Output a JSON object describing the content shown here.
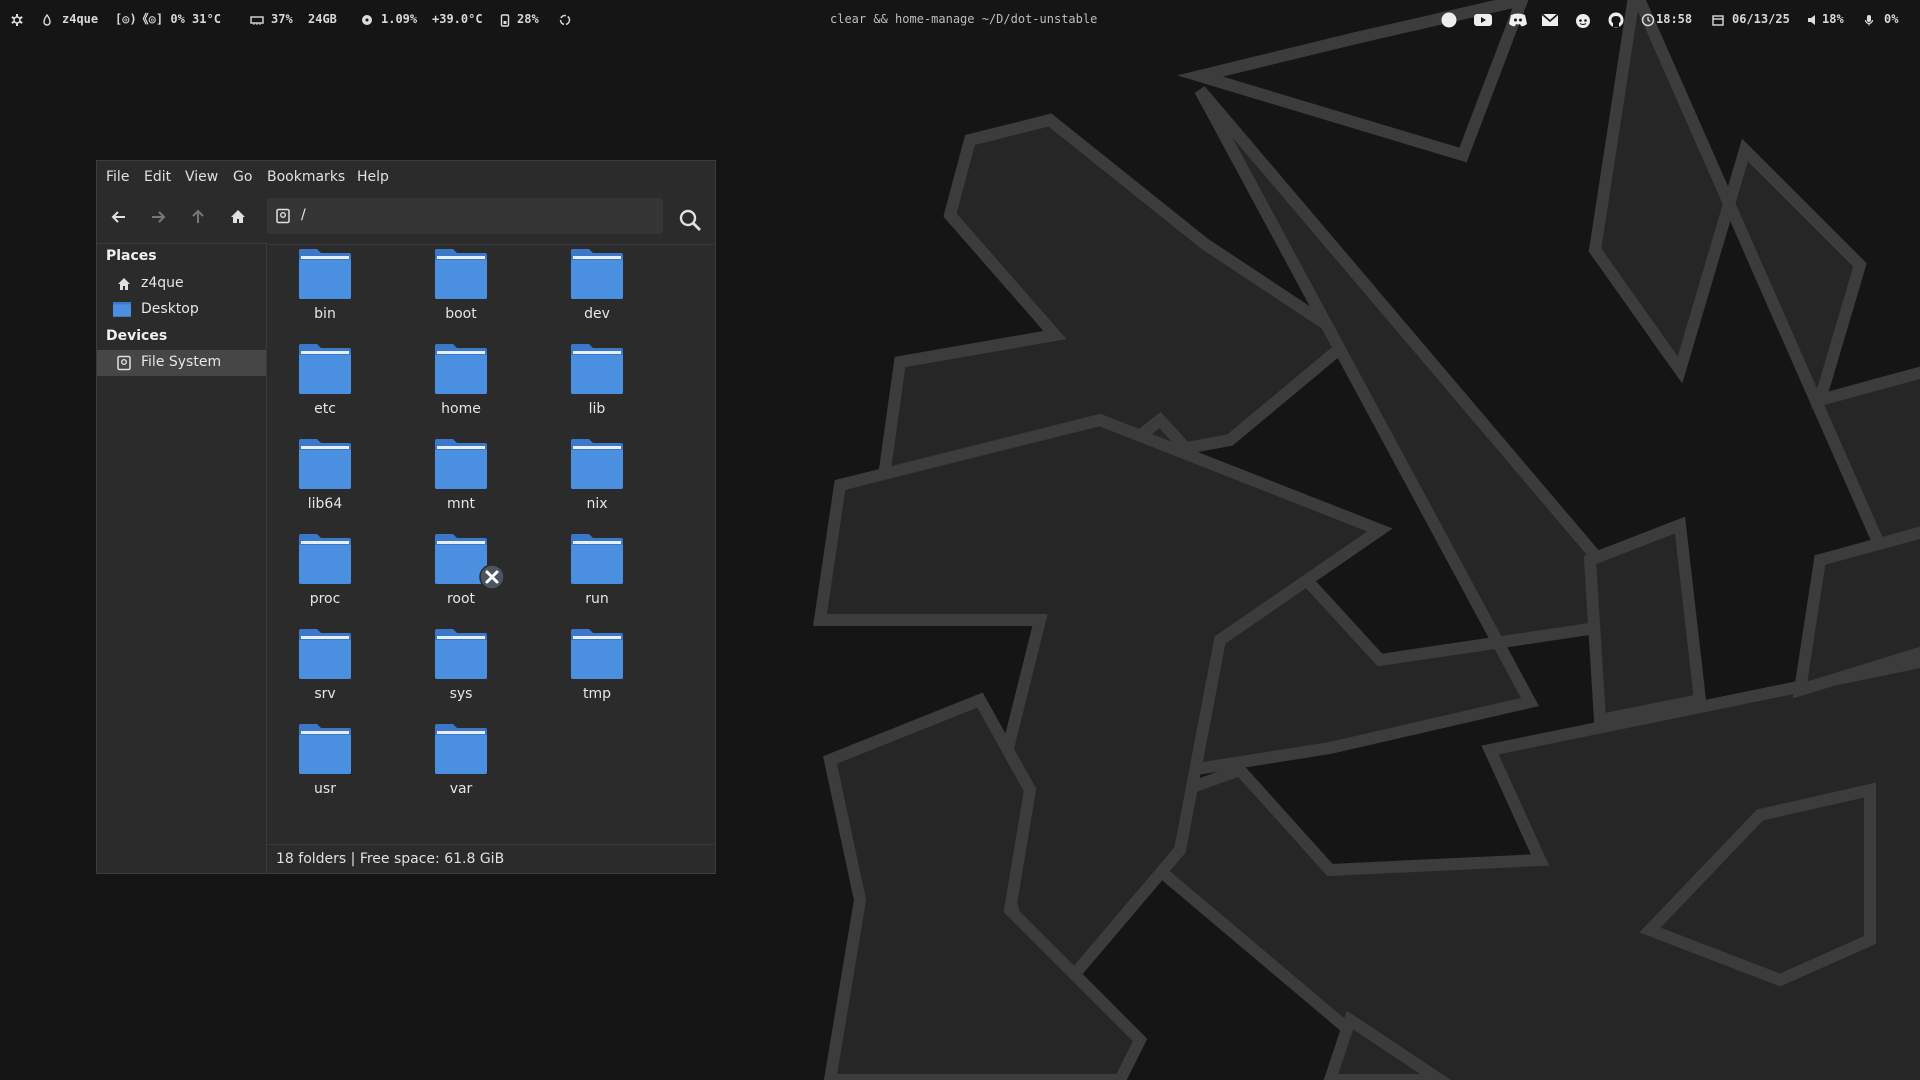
{
  "topbar": {
    "user": "z4que",
    "cpu_label": "[◎)《◎] 0% 31°C",
    "memory": "37%",
    "memory_size": "24GB",
    "disk": "1.09%",
    "temp": "+39.0°C",
    "battery": "28%",
    "window_title": "clear && home-manage ~/D/dot-unstable",
    "clock": "18:58",
    "date": "06/13/25",
    "volume": "18%",
    "mic": "0%"
  },
  "filemanager": {
    "menu": [
      "File",
      "Edit",
      "View",
      "Go",
      "Bookmarks",
      "Help"
    ],
    "location": "/",
    "sidebar": {
      "places_heading": "Places",
      "places": [
        "z4que",
        "Desktop"
      ],
      "devices_heading": "Devices",
      "devices": [
        "File System"
      ]
    },
    "folders": [
      "bin",
      "boot",
      "dev",
      "etc",
      "home",
      "lib",
      "lib64",
      "mnt",
      "nix",
      "proc",
      "root",
      "run",
      "srv",
      "sys",
      "tmp",
      "usr",
      "var"
    ],
    "status": "18 folders  |  Free space: 61.8 GiB"
  },
  "colors": {
    "folder": "#4a8fe0",
    "folder_dark": "#3b78c9",
    "background": "#151515",
    "wallpaper_lines": "#3a3a3a"
  }
}
